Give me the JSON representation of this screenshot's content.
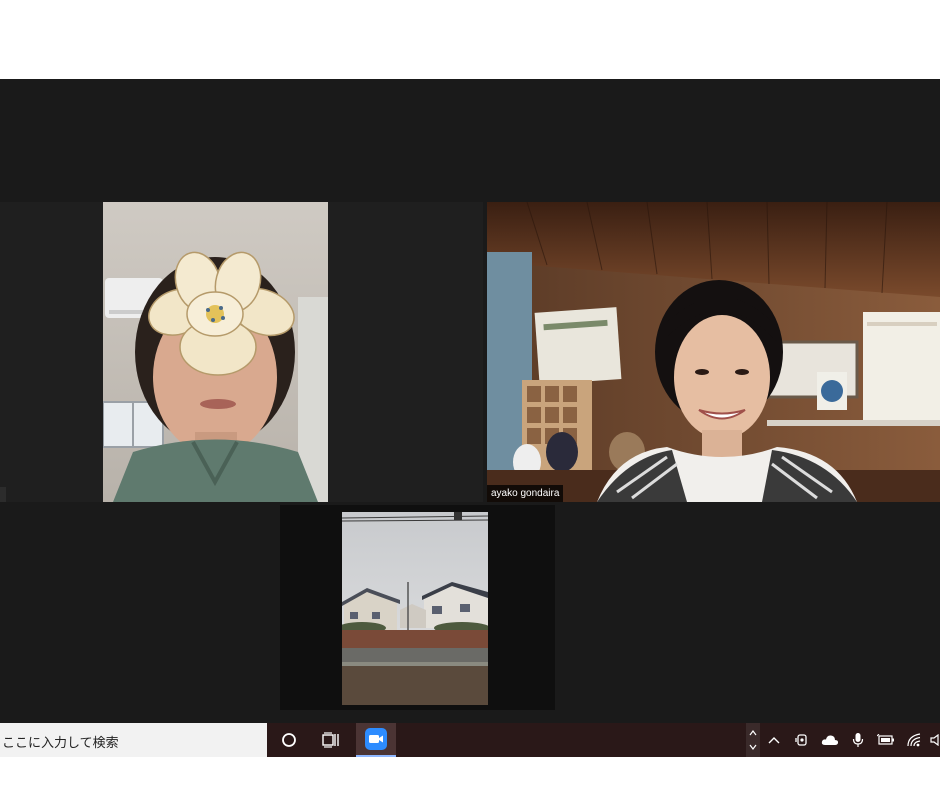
{
  "participants": [
    {
      "id": "participant-1",
      "name": ""
    },
    {
      "id": "participant-2",
      "name": "ayako gondaira"
    },
    {
      "id": "participant-3",
      "name": ""
    }
  ],
  "taskbar": {
    "search_placeholder": "ここに入力して検索",
    "pinned_apps": [
      "cortana-icon",
      "task-view-icon",
      "zoom-icon"
    ],
    "tray_icons": [
      "chevron-up-icon",
      "meet-now-icon",
      "onedrive-cloud-icon",
      "microphone-icon",
      "battery-icon",
      "wifi-icon",
      "volume-icon"
    ]
  },
  "colors": {
    "meeting_background": "#1a1a1a",
    "taskbar_background": "#2a1818",
    "zoom_accent": "#2d8cff"
  }
}
